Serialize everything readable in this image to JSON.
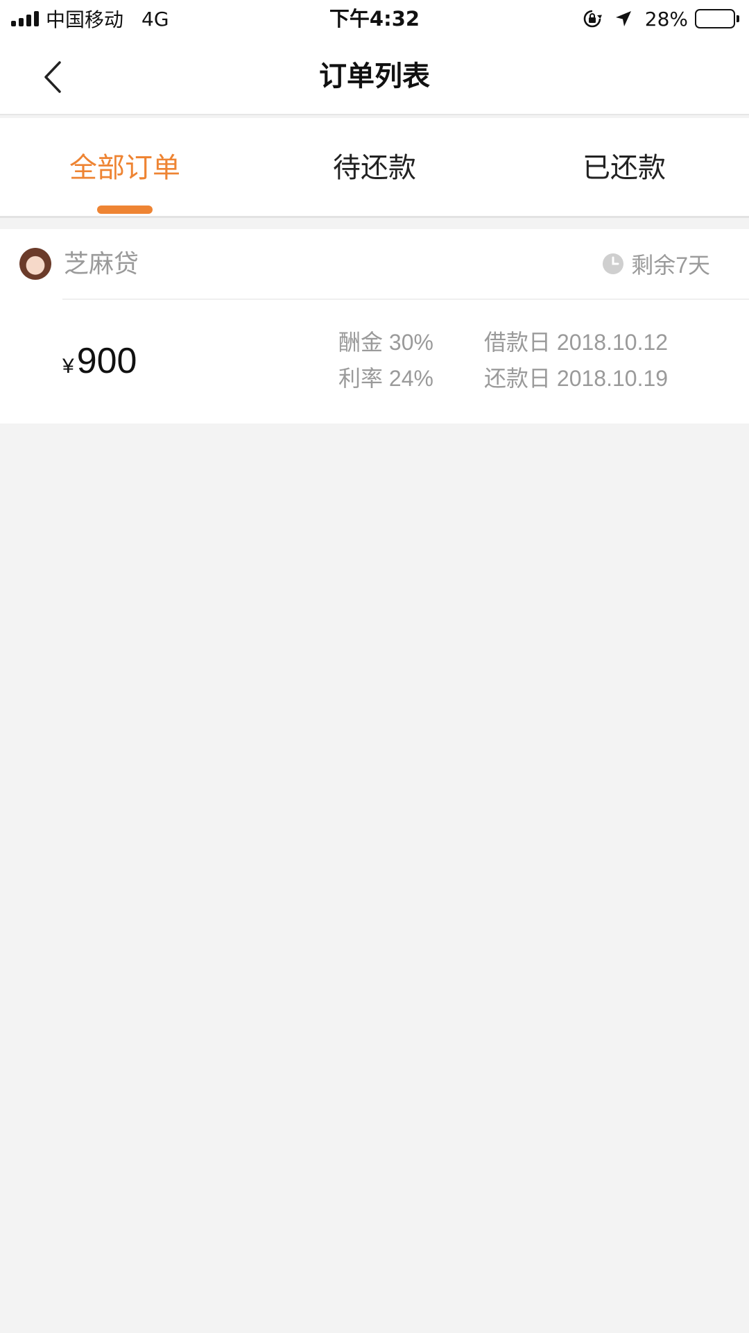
{
  "status_bar": {
    "carrier": "中国移动",
    "network": "4G",
    "time": "下午4:32",
    "battery_percent": "28%",
    "battery_level": 0.28
  },
  "nav": {
    "title": "订单列表",
    "back_icon": "chevron-left-icon"
  },
  "tabs": [
    {
      "label": "全部订单",
      "active": true
    },
    {
      "label": "待还款",
      "active": false
    },
    {
      "label": "已还款",
      "active": false
    }
  ],
  "colors": {
    "accent": "#ee8433",
    "muted_text": "#9a9a9a",
    "background": "#f3f3f3"
  },
  "orders": [
    {
      "lender": "芝麻贷",
      "remaining": "剩余7天",
      "currency": "¥",
      "amount": "900",
      "commission": "酬金 30%",
      "interest": "利率 24%",
      "loan_date": "借款日 2018.10.12",
      "repay_date": "还款日 2018.10.19"
    }
  ]
}
